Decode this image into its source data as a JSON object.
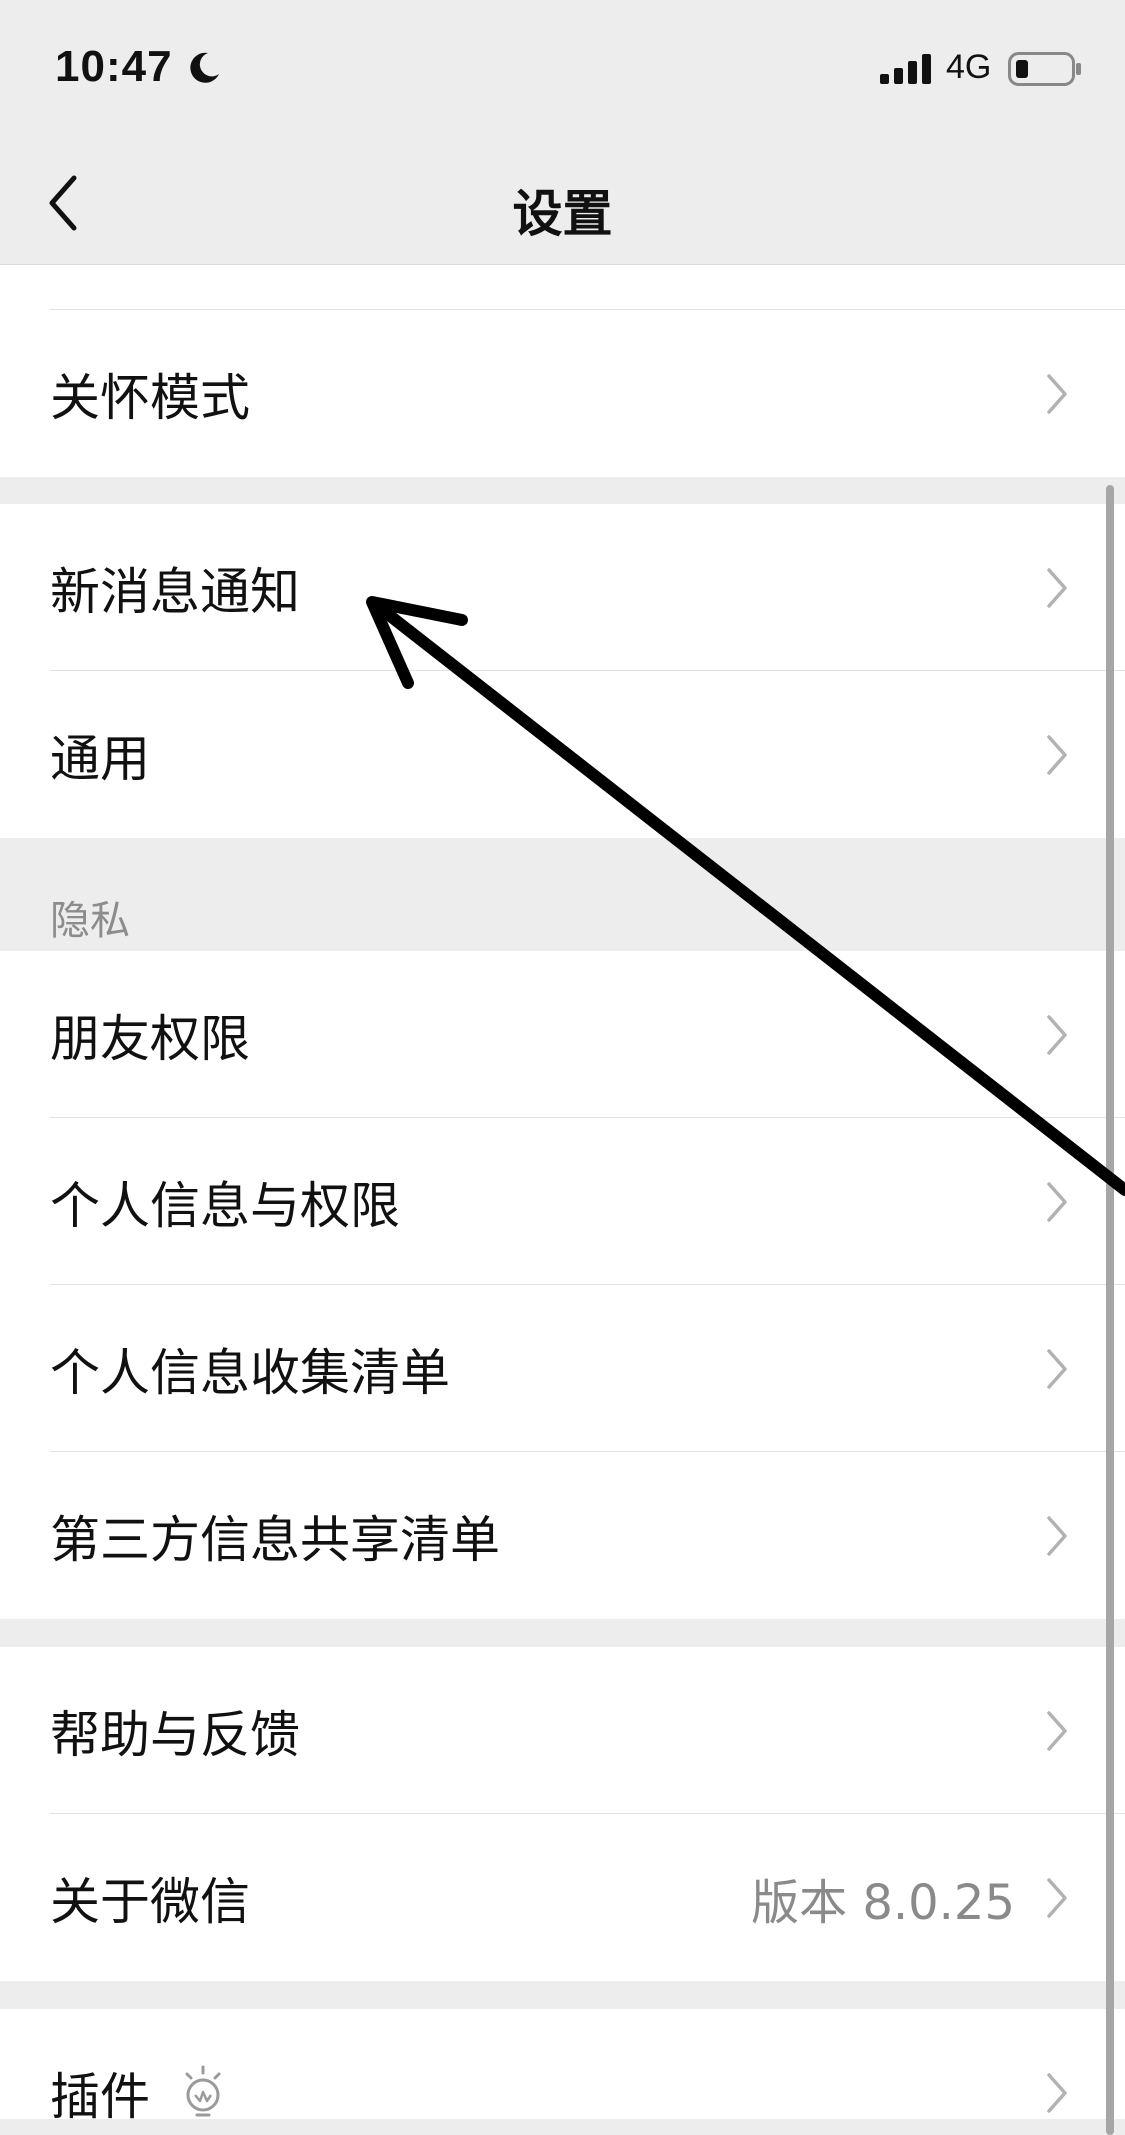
{
  "status_bar": {
    "time": "10:47",
    "network": "4G",
    "icons": [
      "moon-icon",
      "signal-icon",
      "battery-icon"
    ]
  },
  "nav": {
    "title": "设置",
    "back_icon": "chevron-left-icon"
  },
  "groups": {
    "care": {
      "items": [
        {
          "label": "关怀模式"
        }
      ]
    },
    "notify": {
      "items": [
        {
          "label": "新消息通知"
        },
        {
          "label": "通用"
        }
      ]
    },
    "privacy": {
      "header": "隐私",
      "items": [
        {
          "label": "朋友权限"
        },
        {
          "label": "个人信息与权限"
        },
        {
          "label": "个人信息收集清单"
        },
        {
          "label": "第三方信息共享清单"
        }
      ]
    },
    "help": {
      "items": [
        {
          "label": "帮助与反馈"
        },
        {
          "label": "关于微信",
          "value": "版本 8.0.25"
        }
      ]
    },
    "plugins": {
      "items": [
        {
          "label": "插件",
          "icon": "lightbulb-icon"
        }
      ]
    }
  },
  "colors": {
    "background": "#ededed",
    "card": "#ffffff",
    "annotation_arrow": "#000000"
  }
}
